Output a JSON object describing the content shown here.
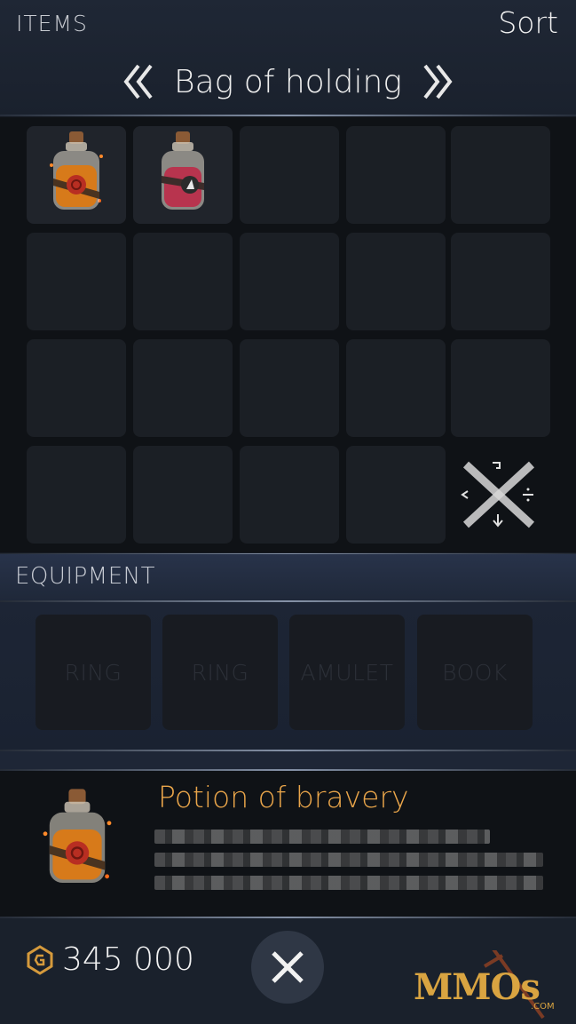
{
  "header": {
    "section_label": "ITEMS",
    "sort_label": "Sort",
    "bag_title": "Bag of holding",
    "prev_icon": "double-chevron-left-icon",
    "next_icon": "double-chevron-right-icon"
  },
  "inventory": {
    "columns": 5,
    "rows": 4,
    "items": [
      {
        "slot": 0,
        "name": "Potion of bravery",
        "icon": "orange-potion-icon",
        "liquid_color": "#d77a1a"
      },
      {
        "slot": 1,
        "icon": "red-potion-icon",
        "liquid_color": "#b8344e"
      }
    ],
    "discard_icon": "discard-rune-icon"
  },
  "equipment": {
    "label": "EQUIPMENT",
    "slots": [
      {
        "label": "RING"
      },
      {
        "label": "RING"
      },
      {
        "label": "AMULET"
      },
      {
        "label": "BOOK"
      }
    ]
  },
  "detail": {
    "item_name": "Potion of bravery",
    "icon": "orange-potion-icon",
    "name_color": "#e9a54a"
  },
  "footer": {
    "gold_icon": "gold-coin-icon",
    "gold_amount": "345 000",
    "close_icon": "close-icon",
    "watermark": "MMOs",
    "watermark_suffix": ".COM"
  }
}
